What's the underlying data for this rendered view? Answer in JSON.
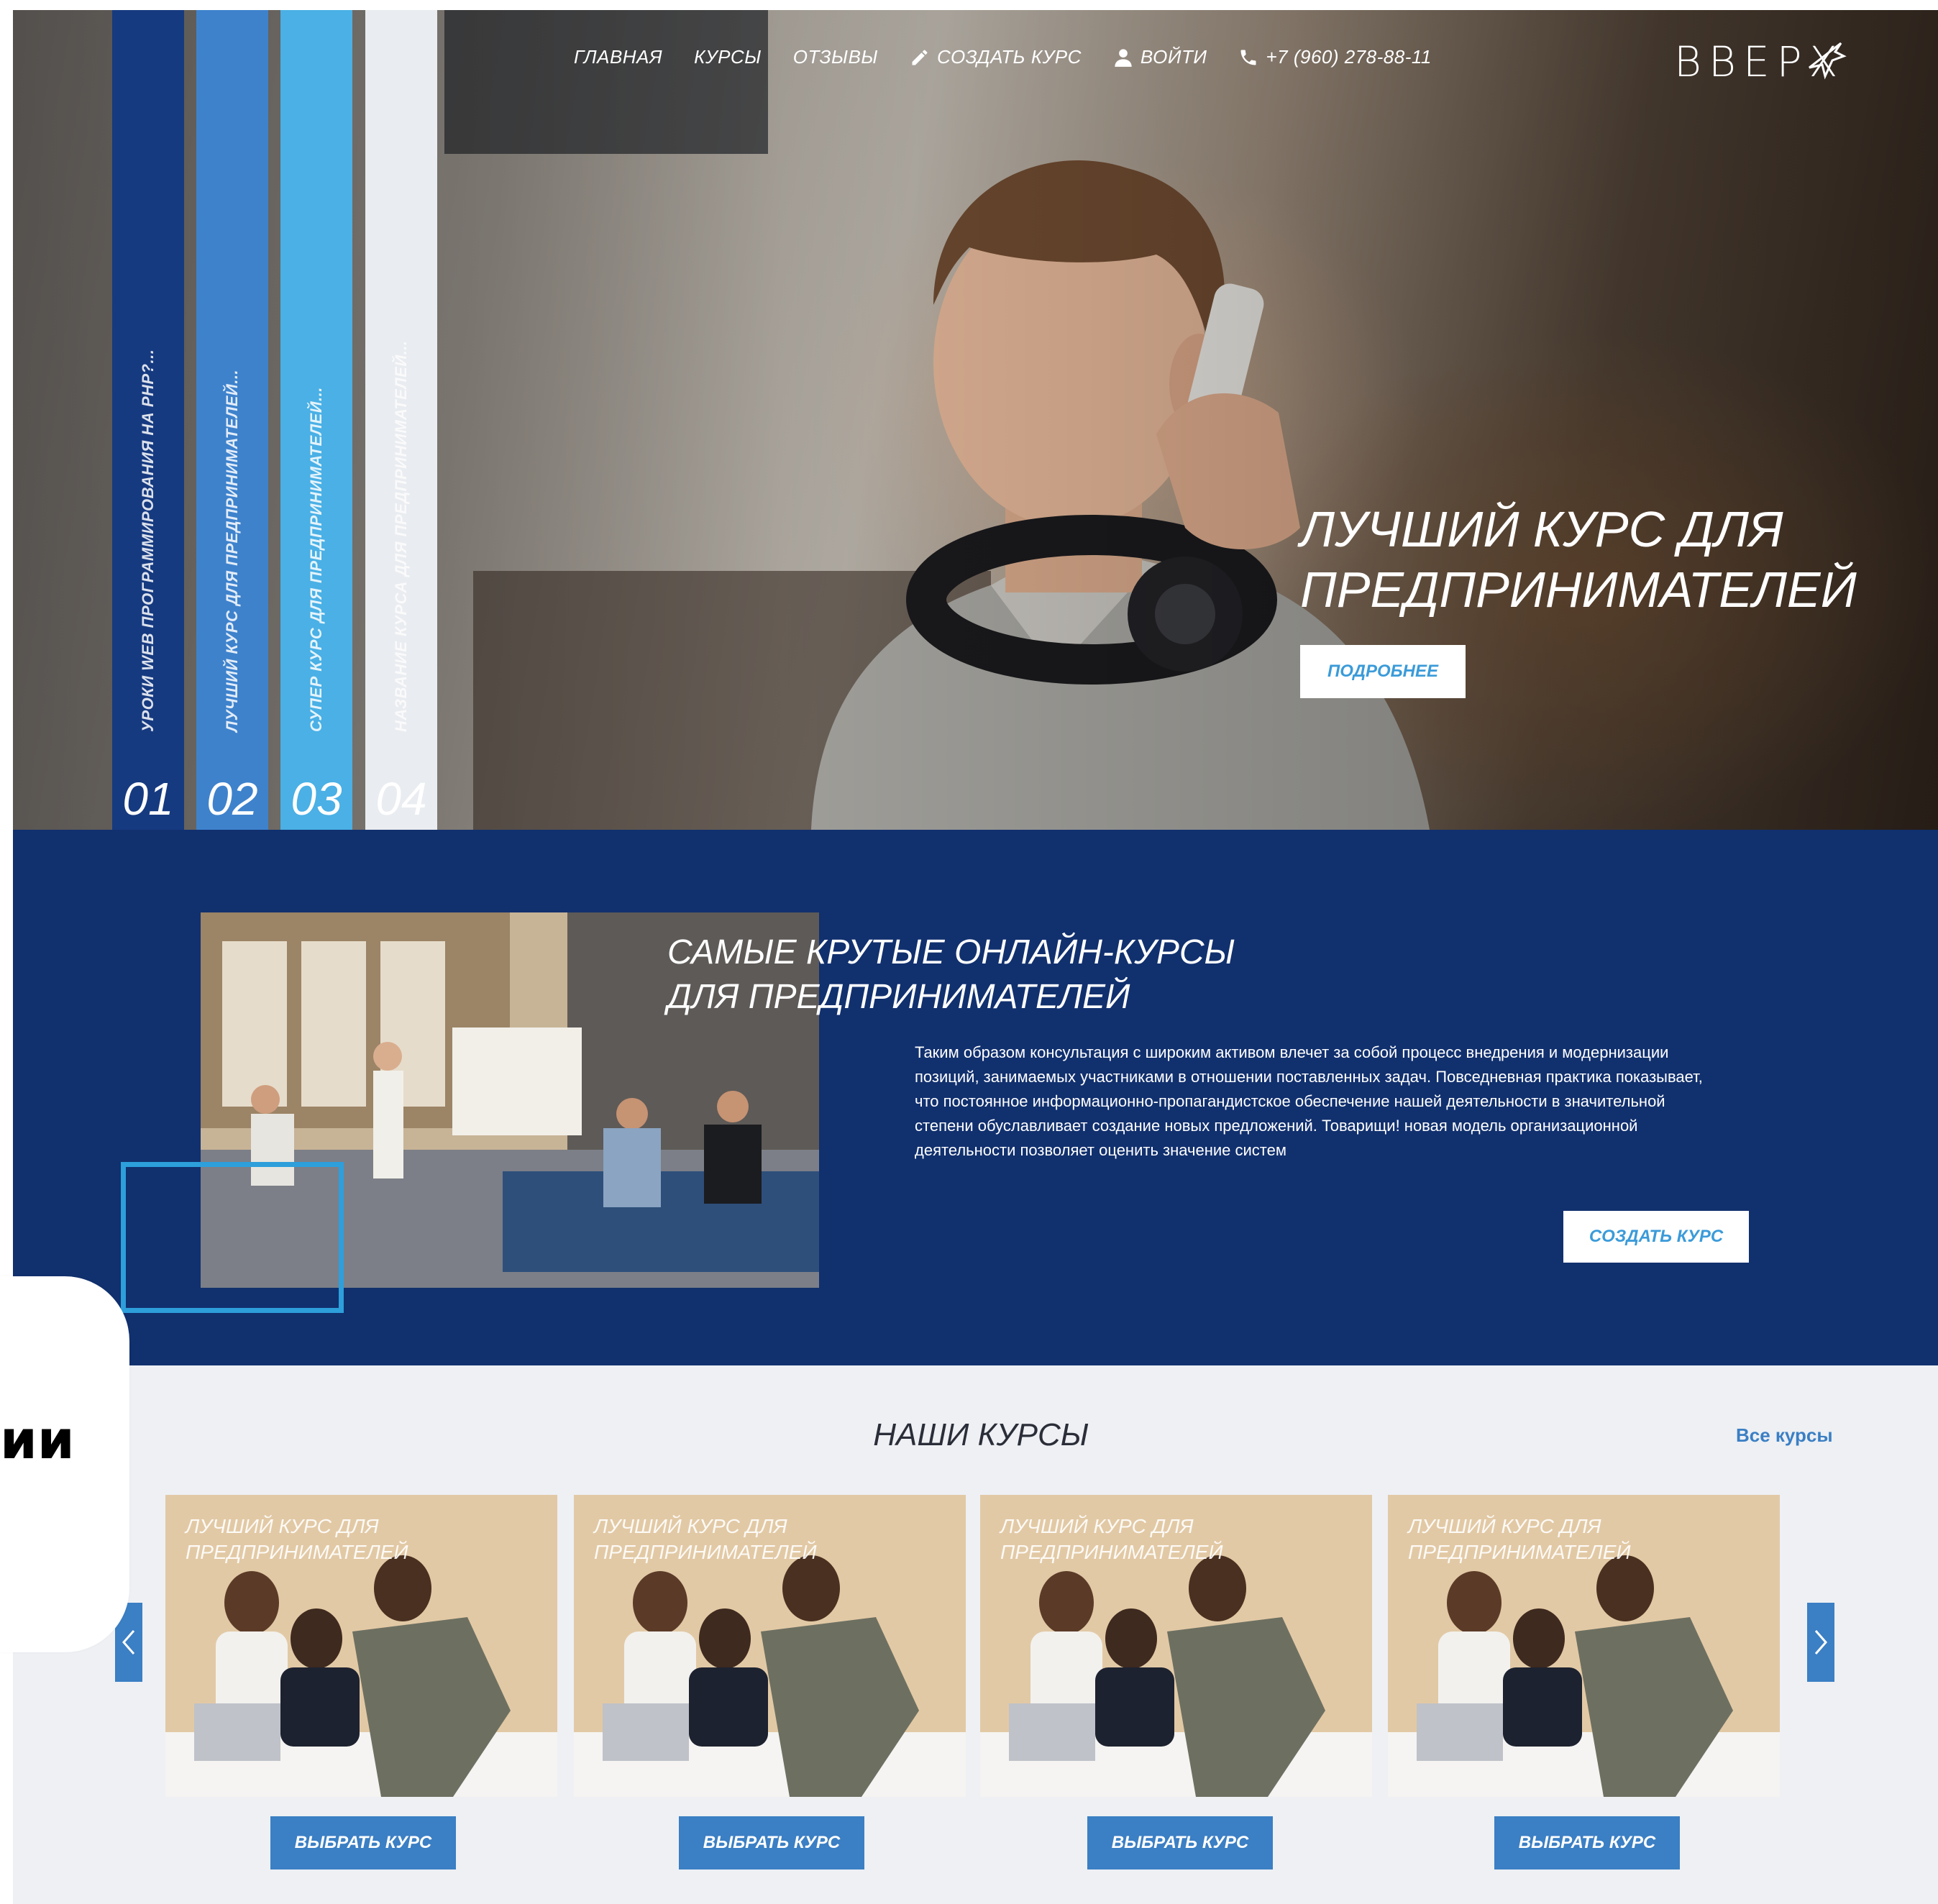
{
  "brand": {
    "logo_text": "ВВЕРХ"
  },
  "nav": {
    "items": [
      {
        "label": "ГЛАВНАЯ"
      },
      {
        "label": "КУРСЫ"
      },
      {
        "label": "ОТЗЫВЫ"
      },
      {
        "label": "СОЗДАТЬ КУРС",
        "icon": "pencil-icon"
      },
      {
        "label": "ВОЙТИ",
        "icon": "user-icon"
      },
      {
        "label": "+7 (960) 278-88-11",
        "icon": "phone-icon"
      }
    ]
  },
  "hero": {
    "slides": [
      {
        "number": "01",
        "label": "УРОКИ WEB ПРОГРАММИРОВАНИЯ НА PHP?...",
        "color": "#163a80"
      },
      {
        "number": "02",
        "label": "ЛУЧШИЙ КУРС ДЛЯ ПРЕДПРИНИМАТЕЛЕЙ...",
        "color": "#3e82cc"
      },
      {
        "number": "03",
        "label": "СУПЕР КУРС ДЛЯ ПРЕДПРИНИМАТЕЛЕЙ...",
        "color": "#4ab0e5"
      },
      {
        "number": "04",
        "label": "НАЗВАНИЕ КУРСА ДЛЯ ПРЕДПРИНИМАТЕЛЕЙ...",
        "color": "#e9ecf0"
      }
    ],
    "title": "ЛУЧШИЙ КУРС ДЛЯ ПРЕДПРИНИМАТЕЛЕЙ",
    "more_button": "ПОДРОБНЕЕ"
  },
  "about": {
    "title": "САМЫЕ КРУТЫЕ ОНЛАЙН-КУРСЫ ДЛЯ ПРЕДПРИНИМАТЕЛЕЙ",
    "text": "Таким образом консультация с широким активом влечет за собой процесс внедрения и модернизации позиций, занимаемых участниками в отношении поставленных задач. Повседневная практика показывает, что постоянное информационно-пропагандистское обеспечение нашей деятельности в значительной степени обуславливает создание новых предложений. Товарищи! новая модель организационной деятельности позволяет оценить значение систем",
    "create_button": "СОЗДАТЬ КУРС"
  },
  "courses": {
    "title": "НАШИ КУРСЫ",
    "all_link": "Все курсы",
    "items": [
      {
        "title": "ЛУЧШИЙ КУРС ДЛЯ ПРЕДПРИНИМАТЕЛЕЙ",
        "button": "ВЫБРАТЬ КУРС"
      },
      {
        "title": "ЛУЧШИЙ КУРС ДЛЯ ПРЕДПРИНИМАТЕЛЕЙ",
        "button": "ВЫБРАТЬ КУРС"
      },
      {
        "title": "ЛУЧШИЙ КУРС ДЛЯ ПРЕДПРИНИМАТЕЛЕЙ",
        "button": "ВЫБРАТЬ КУРС"
      },
      {
        "title": "ЛУЧШИЙ КУРС ДЛЯ ПРЕДПРИНИМАТЕЛЕЙ",
        "button": "ВЫБРАТЬ КУРС"
      }
    ]
  },
  "overlay": {
    "text": "ии"
  },
  "colors": {
    "navy": "#11306e",
    "accent_blue": "#3b7fc4",
    "light_blue": "#2d9fdb",
    "section_bg": "#eef0f4"
  }
}
